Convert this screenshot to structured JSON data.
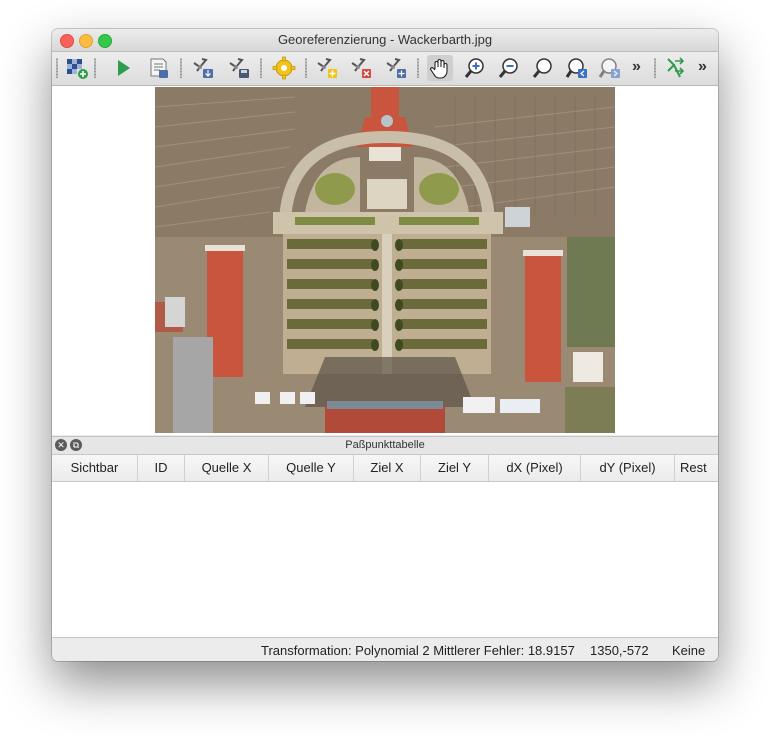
{
  "window": {
    "title": "Georeferenzierung - Wackerbarth.jpg"
  },
  "toolbar": {
    "buttons": [
      {
        "icon": "open-raster-icon"
      },
      {
        "icon": "start-georeferencing-icon"
      },
      {
        "icon": "generate-gdal-script-icon"
      },
      {
        "icon": "load-gcp-points-icon"
      },
      {
        "icon": "save-gcp-points-icon"
      },
      {
        "icon": "transformation-settings-icon"
      },
      {
        "icon": "add-point-icon"
      },
      {
        "icon": "delete-point-icon"
      },
      {
        "icon": "move-gcp-point-icon"
      },
      {
        "icon": "pan-hand-icon"
      },
      {
        "icon": "zoom-in-icon"
      },
      {
        "icon": "zoom-out-icon"
      },
      {
        "icon": "zoom-to-layer-icon"
      },
      {
        "icon": "zoom-last-icon"
      },
      {
        "icon": "zoom-next-icon"
      },
      {
        "icon": "link-georeferencer-to-qgis-icon"
      }
    ],
    "overflow_label": "»"
  },
  "dock": {
    "title": "Paßpunkttabelle"
  },
  "table": {
    "columns": [
      "Sichtbar",
      "ID",
      "Quelle X",
      "Quelle Y",
      "Ziel X",
      "Ziel Y",
      "dX (Pixel)",
      "dY (Pixel)",
      "Rest"
    ],
    "rows": []
  },
  "status": {
    "transformation": "Transformation: Polynomial 2 Mittlerer Fehler: 18.9157",
    "coordinates": "1350,-572",
    "crs": "Keine"
  },
  "colors": {
    "accent_green": "#2e9c4b",
    "roof_red": "#c9553f",
    "vineyard_brown": "#8b7a66"
  }
}
